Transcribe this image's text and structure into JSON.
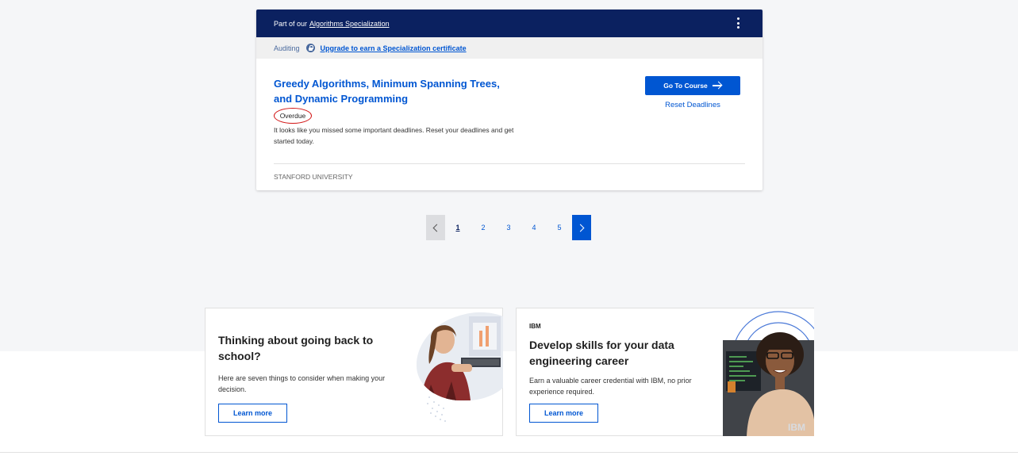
{
  "course_card": {
    "header_prefix": "Part of our",
    "specialization_link": "Algorithms Specialization",
    "audit_label": "Auditing",
    "upgrade_link": "Upgrade to earn a Specialization certificate",
    "title": "Greedy Algorithms, Minimum Spanning Trees, and Dynamic Programming",
    "status_badge": "Overdue",
    "description": "It looks like you missed some important deadlines. Reset your deadlines and get started today.",
    "go_to_course_label": "Go To Course",
    "reset_deadlines_label": "Reset Deadlines",
    "university": "STANFORD UNIVERSITY",
    "icons": [
      "more-vertical-icon",
      "lock-icon",
      "arrow-right-icon"
    ]
  },
  "pagination": {
    "pages": [
      "1",
      "2",
      "3",
      "4",
      "5"
    ],
    "current_page": "1",
    "icons": [
      "chevron-left-icon",
      "chevron-right-icon"
    ]
  },
  "promos": [
    {
      "title": "Thinking about going back to school?",
      "description": "Here are seven things to consider when making your decision.",
      "button_label": "Learn more"
    },
    {
      "brand": "IBM",
      "title": "Develop skills for your data engineering career",
      "description": "Earn a valuable career credential with IBM, no prior experience required.",
      "button_label": "Learn more",
      "image_watermark": "IBM"
    }
  ],
  "colors": {
    "header_navy": "#0b2160",
    "primary_blue": "#0056d2",
    "overdue_red": "#d21414",
    "page_background": "#f5f6f8"
  }
}
